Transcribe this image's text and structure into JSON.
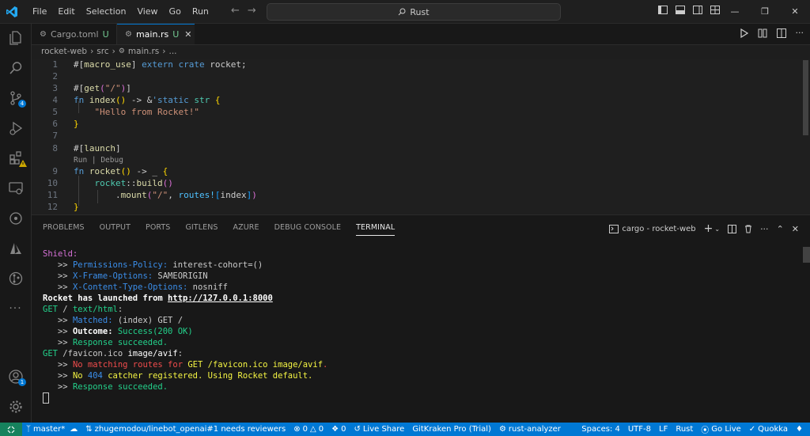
{
  "menu": [
    "File",
    "Edit",
    "Selection",
    "View",
    "Go",
    "Run"
  ],
  "search": {
    "text": "Rust"
  },
  "tabs": [
    {
      "label": "Cargo.toml",
      "status": "U",
      "active": false
    },
    {
      "label": "main.rs",
      "status": "U",
      "active": true
    }
  ],
  "breadcrumb": [
    "rocket-web",
    "src",
    "main.rs",
    "..."
  ],
  "activity": {
    "scm_badge": "4",
    "accounts_badge": "1"
  },
  "editor": {
    "line_numbers": [
      "1",
      "2",
      "3",
      "4",
      "5",
      "6",
      "7",
      "8",
      "9",
      "10",
      "11",
      "12"
    ],
    "codelens": "Run | Debug"
  },
  "panel": {
    "tabs": [
      "PROBLEMS",
      "OUTPUT",
      "PORTS",
      "GITLENS",
      "AZURE",
      "DEBUG CONSOLE",
      "TERMINAL"
    ],
    "terminal_name": "cargo - rocket-web"
  },
  "terminal_lines": [
    "Shield:",
    ">> Permissions-Policy: interest-cohort=()",
    ">> X-Frame-Options: SAMEORIGIN",
    ">> X-Content-Type-Options: nosniff",
    "Rocket has launched from http://127.0.0.1:8000",
    "GET / text/html:",
    ">> Matched: (index) GET /",
    ">> Outcome: Success(200 OK)",
    ">> Response succeeded.",
    "GET /favicon.ico image/avif:",
    ">> No matching routes for GET /favicon.ico image/avif.",
    ">> No 404 catcher registered. Using Rocket default.",
    ">> Response succeeded."
  ],
  "status": {
    "branch": "master*",
    "pr": "zhugemodou/linebot_openai#1 needs reviewers",
    "errors": "0",
    "warnings": "0",
    "ports": "0",
    "liveshare": "Live Share",
    "gitkraken": "GitKraken Pro (Trial)",
    "analyzer": "rust-analyzer",
    "spaces": "Spaces: 4",
    "encoding": "UTF-8",
    "eol": "LF",
    "language": "Rust",
    "golive": "Go Live",
    "quokka": "Quokka"
  },
  "colors": {
    "accent": "#0078d4",
    "statusbar": "#0078d4",
    "remote": "#16825d"
  }
}
